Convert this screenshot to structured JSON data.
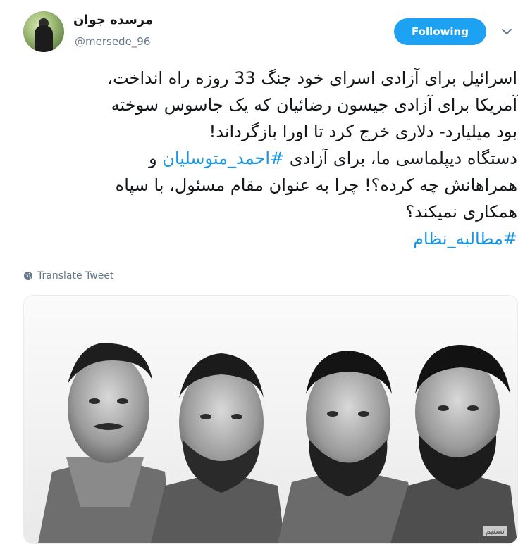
{
  "user": {
    "name": "مرسده جوان",
    "handle": "@mersede_96"
  },
  "follow_button": {
    "label": "Following"
  },
  "tweet": {
    "lines": [
      "اسرائیل برای آزادی اسرای خود جنگ 33 روزه راه انداخت،",
      "آمریکا برای آزادی جیسون رضائیان که یک جاسوس سوخته",
      "بود میلیارد- دلاری خرج کرد تا اورا بازگرداند!",
      "دستگاه دیپلماسی ما، برای آزادی ",
      "همراهانش چه کرده؟! چرا به عنوان مقام مسئول، با سپاه",
      "همکاری نمیکند؟"
    ],
    "line4_hashtag": "#احمد_متوسلیان",
    "line4_suffix": " و",
    "hashtag_line": "#مطالبه_نظام"
  },
  "translate": {
    "label": "Translate Tweet"
  },
  "media": {
    "watermark": "تسنیم"
  },
  "colors": {
    "accent": "#1da1f2",
    "hashtag": "#1b95e0",
    "secondary_text": "#657786"
  }
}
